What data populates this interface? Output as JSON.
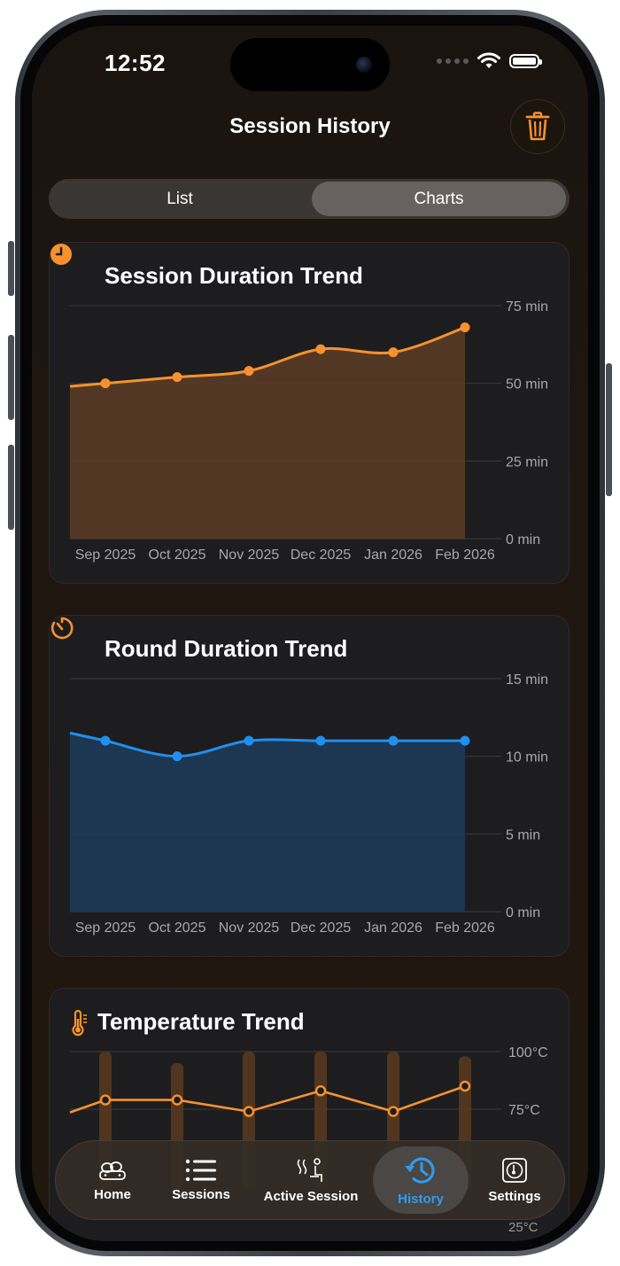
{
  "status_bar": {
    "time": "12:52"
  },
  "header": {
    "title": "Session History",
    "trash_icon": "trash-icon"
  },
  "segments": {
    "list": "List",
    "charts": "Charts",
    "selected": "Charts"
  },
  "tab_bar": {
    "items": [
      {
        "label": "Home",
        "icon": "sauna-stones-icon"
      },
      {
        "label": "Sessions",
        "icon": "list-icon"
      },
      {
        "label": "Active Session",
        "icon": "steam-person-icon"
      },
      {
        "label": "History",
        "icon": "clock-history-icon"
      },
      {
        "label": "Settings",
        "icon": "thermometer-gauge-icon"
      }
    ],
    "active": "History"
  },
  "peek_label": "25°C",
  "colors": {
    "orange": "#f7922e",
    "blue": "#1f8ff0",
    "orange_fill": "#5a3b26",
    "blue_fill": "#1e3a56"
  },
  "chart_data": [
    {
      "type": "area",
      "title": "Session Duration Trend",
      "icon": "clock-icon",
      "categories": [
        "Sep 2025",
        "Oct 2025",
        "Nov 2025",
        "Dec 2025",
        "Jan 2026",
        "Feb 2026"
      ],
      "values": [
        50,
        52,
        54,
        61,
        60,
        68
      ],
      "y_ticks": [
        "0 min",
        "25 min",
        "50 min",
        "75 min"
      ],
      "ylim": [
        0,
        75
      ],
      "grid": true
    },
    {
      "type": "area",
      "title": "Round Duration Trend",
      "icon": "timer-icon",
      "categories": [
        "Sep 2025",
        "Oct 2025",
        "Nov 2025",
        "Dec 2025",
        "Jan 2026",
        "Feb 2026"
      ],
      "values": [
        11,
        10,
        11,
        11,
        11,
        11
      ],
      "y_ticks": [
        "0 min",
        "5 min",
        "10 min",
        "15 min"
      ],
      "ylim": [
        0,
        15
      ],
      "grid": true
    },
    {
      "type": "line",
      "title": "Temperature Trend",
      "icon": "thermometer-icon",
      "values": [
        79,
        79,
        74,
        83,
        74,
        85
      ],
      "range_bars": [
        [
          40,
          100
        ],
        [
          40,
          95
        ],
        [
          40,
          100
        ],
        [
          40,
          100
        ],
        [
          40,
          100
        ],
        [
          40,
          98
        ]
      ],
      "y_ticks": [
        "75°C",
        "100°C"
      ],
      "ylim": [
        25,
        100
      ],
      "grid": true
    }
  ]
}
